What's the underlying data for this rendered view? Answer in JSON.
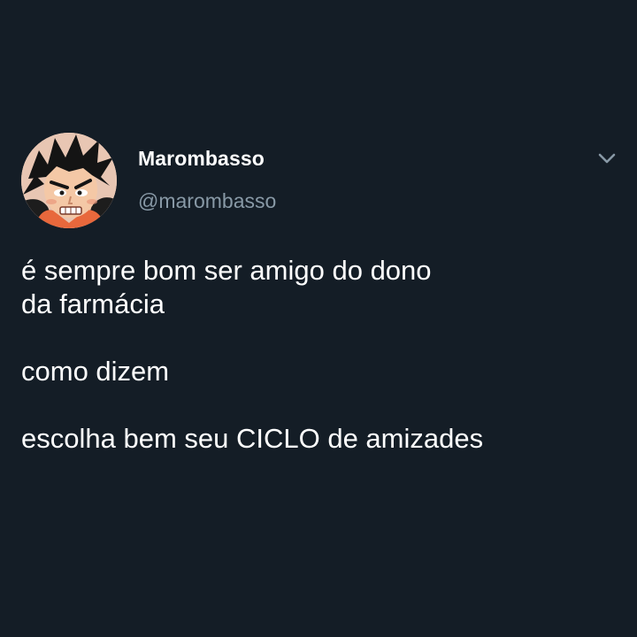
{
  "tweet": {
    "display_name": "Marombasso",
    "handle": "@marombasso",
    "text": "é sempre bom ser amigo do dono\nda farmácia\n\ncomo dizem\n\nescolha bem seu CICLO de amizades"
  },
  "icons": {
    "avatar": "cartoon-face-avatar",
    "menu": "chevron-down-icon"
  },
  "colors": {
    "background": "#141d26",
    "primary_text": "#ffffff",
    "secondary_text": "#8899a6"
  }
}
